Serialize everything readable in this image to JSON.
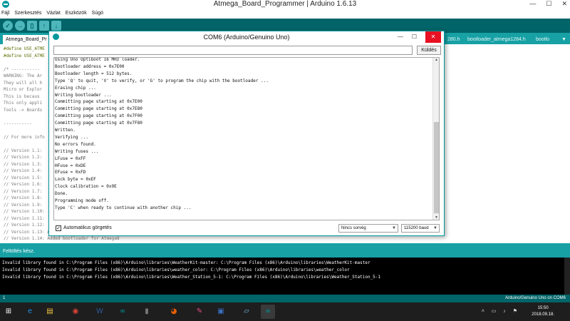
{
  "window": {
    "title": "Atmega_Board_Programmer | Arduino 1.6.13",
    "min": "—",
    "max": "☐",
    "close": "✕"
  },
  "menu": [
    "Fájl",
    "Szerkesztés",
    "Vázlat",
    "Eszközök",
    "Súgó"
  ],
  "tabs": [
    "Atmega_Board_Pr",
    "280.h",
    "bootloader_atmega1284.h",
    "bootlo",
    "▼"
  ],
  "editor_lines": [
    {
      "text": "#define USE_ATME",
      "kind": "def"
    },
    {
      "text": "#define USE_ATME",
      "kind": "def"
    },
    {
      "text": "",
      "kind": "cmt"
    },
    {
      "text": "/* -----------",
      "kind": "cmt"
    },
    {
      "text": "WARNING: The Ar",
      "kind": "cmt"
    },
    {
      "text": "They will all h",
      "kind": "cmt"
    },
    {
      "text": "Micro or Explor",
      "kind": "cmt"
    },
    {
      "text": "This is becaus",
      "kind": "cmt"
    },
    {
      "text": "This only appli",
      "kind": "cmt"
    },
    {
      "text": "Tools -> Boards",
      "kind": "cmt"
    },
    {
      "text": "",
      "kind": "cmt"
    },
    {
      "text": "-----------",
      "kind": "cmt"
    },
    {
      "text": "",
      "kind": "cmt"
    },
    {
      "text": "// For more info",
      "kind": "cmt"
    },
    {
      "text": "",
      "kind": "cmt"
    },
    {
      "text": "// Version 1.1:",
      "kind": "cmt"
    },
    {
      "text": "// Version 1.2:",
      "kind": "cmt"
    },
    {
      "text": "// Version 1.3:",
      "kind": "cmt"
    },
    {
      "text": "// Version 1.4:",
      "kind": "cmt"
    },
    {
      "text": "// Version 1.5:",
      "kind": "cmt"
    },
    {
      "text": "// Version 1.6:",
      "kind": "cmt"
    },
    {
      "text": "// Version 1.7:",
      "kind": "cmt"
    },
    {
      "text": "// Version 1.8:",
      "kind": "cmt"
    },
    {
      "text": "// Version 1.9:",
      "kind": "cmt"
    },
    {
      "text": "// Version 1.10:",
      "kind": "cmt"
    },
    {
      "text": "// Version 1.11:",
      "kind": "cmt"
    },
    {
      "text": "// Version 1.12:",
      "kind": "cmt"
    },
    {
      "text": "// Version 1.13: Added signature for Atmega8A",
      "kind": "cmt"
    },
    {
      "text": "// Version 1.14: Added bootloader for Atmega8",
      "kind": "cmt"
    }
  ],
  "status": "Feltöltés kész.",
  "console_lines": [
    "Invalid library found in C:\\Program Files (x86)\\Arduino\\libraries\\WeatherKit-master: C:\\Program Files (x86)\\Arduino\\libraries\\WeatherKit-master",
    "Invalid library found in C:\\Program Files (x86)\\Arduino\\libraries\\weather_color: C:\\Program Files (x86)\\Arduino\\libraries\\weather_color",
    "Invalid library found in C:\\Program Files (x86)\\Arduino\\libraries\\Weather_Station_5-1: C:\\Program Files (x86)\\Arduino\\libraries\\Weather_Station_5-1"
  ],
  "footer": {
    "left": "1",
    "right": "Arduino/Genuino Uno on COM6"
  },
  "serial": {
    "title": "COM6 (Arduino/Genuino Uno)",
    "min": "—",
    "max": "☐",
    "close": "✕",
    "input_value": "",
    "send_label": "Küldés",
    "scroll_up": "▲",
    "scroll_down": "▼",
    "output": [
      "Using Uno Optiboot 16 MHz loader.",
      "Bootloader address = 0x7E00",
      "Bootloader length = 512 bytes.",
      "Type 'Q' to quit, 'V' to verify, or 'G' to program the chip with the bootloader ...",
      "Erasing chip ...",
      "Writing bootloader ...",
      "Committing page starting at 0x7E00",
      "Committing page starting at 0x7E80",
      "Committing page starting at 0x7F00",
      "Committing page starting at 0x7F80",
      "Written.",
      "Verifying ...",
      "No errors found.",
      "Writing fuses ...",
      "LFuse = 0xFF",
      "HFuse = 0xDE",
      "EFuse = 0xFD",
      "Lock byte = 0xEF",
      "Clock calibration = 0x9E",
      "Done.",
      "Programming mode off.",
      "Type 'C' when ready to continue with another chip ..."
    ],
    "autoscroll_checked": "✓",
    "autoscroll_label": "Automatikus görgetés",
    "line_ending": "Nincs sorvég",
    "baud": "115200 baud",
    "dropdown_arrow": "▼"
  },
  "taskbar": {
    "clock_time": "15:50",
    "clock_date": "2018.09.18.",
    "tray": "˄ ▭ ♪ ⚑",
    "icons": [
      {
        "name": "ie-icon",
        "glyph": "e",
        "color": "#1e8fe0"
      },
      {
        "name": "file-explorer-icon",
        "glyph": "▤",
        "color": "#f4c542"
      },
      {
        "name": "chrome-icon",
        "glyph": "◉",
        "color": "#db4437"
      },
      {
        "name": "word-icon",
        "glyph": "W",
        "color": "#2b5797"
      },
      {
        "name": "arduino-icon",
        "glyph": "∞",
        "color": "#00979c"
      },
      {
        "name": "battery-app-icon",
        "glyph": "▮",
        "color": "#7a7a7a"
      },
      {
        "name": "firefox-icon",
        "glyph": "◕",
        "color": "#e66000"
      },
      {
        "name": "paint-icon",
        "glyph": "✎",
        "color": "#e94d8b"
      },
      {
        "name": "save-disk-icon",
        "glyph": "▣",
        "color": "#3a6fc4"
      },
      {
        "name": "notepad-icon",
        "glyph": "▱",
        "color": "#6fb8d8"
      },
      {
        "name": "arduino-ide-icon",
        "glyph": "∞",
        "color": "#00979c"
      }
    ]
  }
}
